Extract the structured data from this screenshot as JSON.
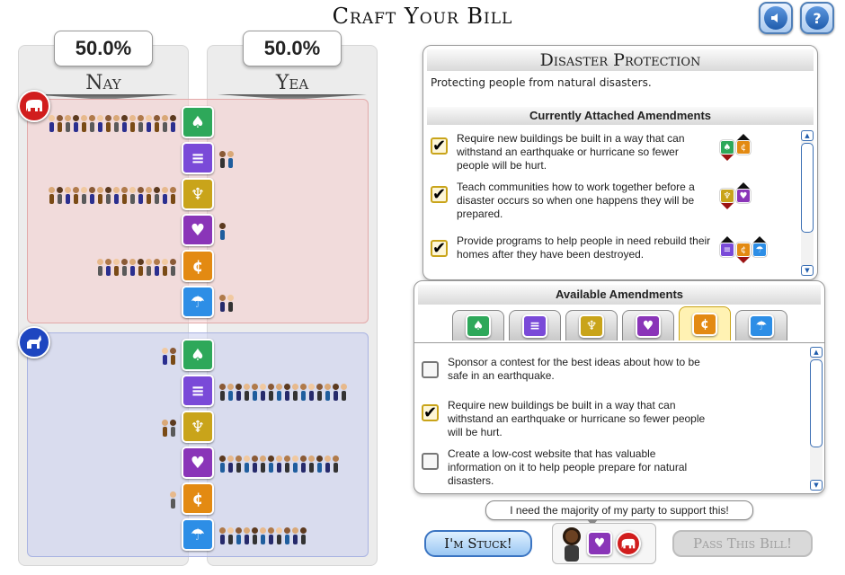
{
  "title": "Craft Your Bill",
  "header_buttons": {
    "sound_icon": "speaker-icon",
    "help_label": "?"
  },
  "columns": {
    "nay": {
      "label": "Nay",
      "percent": "50.0%"
    },
    "yea": {
      "label": "Yea",
      "percent": "50.0%"
    }
  },
  "parties": [
    {
      "name": "Republican",
      "logo_icon": "elephant-icon",
      "color": "#d11d1d",
      "rows": [
        {
          "category": "green-sprout-icon",
          "nay_count": 16,
          "yea_count": 0
        },
        {
          "category": "purple-bars-icon",
          "nay_count": 0,
          "yea_count": 2
        },
        {
          "category": "gold-trophy-icon",
          "nay_count": 16,
          "yea_count": 0
        },
        {
          "category": "purple-handshake-icon",
          "nay_count": 0,
          "yea_count": 1
        },
        {
          "category": "orange-cent-icon",
          "nay_count": 10,
          "yea_count": 0
        },
        {
          "category": "blue-umbrella-icon",
          "nay_count": 0,
          "yea_count": 2
        }
      ]
    },
    {
      "name": "Democrat",
      "logo_icon": "donkey-icon",
      "color": "#1e46c0",
      "rows": [
        {
          "category": "green-sprout-icon",
          "nay_count": 2,
          "yea_count": 0
        },
        {
          "category": "purple-bars-icon",
          "nay_count": 0,
          "yea_count": 16
        },
        {
          "category": "gold-trophy-icon",
          "nay_count": 2,
          "yea_count": 0
        },
        {
          "category": "purple-handshake-icon",
          "nay_count": 0,
          "yea_count": 15
        },
        {
          "category": "orange-cent-icon",
          "nay_count": 1,
          "yea_count": 0
        },
        {
          "category": "blue-umbrella-icon",
          "nay_count": 0,
          "yea_count": 11
        }
      ]
    }
  ],
  "category_colors": {
    "green": "#2ea85a",
    "purple1": "#7a4ad8",
    "gold": "#c9a41a",
    "purple2": "#8a35b8",
    "orange": "#e38a12",
    "blue": "#2d8ee6"
  },
  "bill": {
    "title": "Disaster Protection",
    "description": "Protecting people from natural disasters.",
    "attached_header": "Currently Attached Amendments",
    "attached": [
      {
        "text": "Require new buildings be built in a way that can withstand an earthquake or hurricane so fewer people will be hurt.",
        "checked": true
      },
      {
        "text": "Teach communities how to work together before a disaster occurs so when one happens they will be prepared.",
        "checked": true
      },
      {
        "text": "Provide programs to help people in need rebuild their homes after they have been destroyed.",
        "checked": true
      }
    ]
  },
  "available": {
    "header": "Available Amendments",
    "tabs": [
      "green-sprout-icon",
      "purple-bars-icon",
      "gold-trophy-icon",
      "purple-handshake-icon",
      "orange-cent-icon",
      "blue-umbrella-icon"
    ],
    "active_tab": 4,
    "items": [
      {
        "text": "Sponsor a contest for the best ideas about how to be safe in an earthquake.",
        "checked": false
      },
      {
        "text": "Require new buildings be built in a way that can withstand an earthquake or hurricane so fewer people will be hurt.",
        "checked": true
      },
      {
        "text": "Create a low-cost website that has valuable information on it to help people prepare for natural disasters.",
        "checked": false
      }
    ]
  },
  "advisor": {
    "speech": "I need the majority of my party to support this!"
  },
  "buttons": {
    "stuck": "I'm Stuck!",
    "pass": "Pass This Bill!"
  }
}
